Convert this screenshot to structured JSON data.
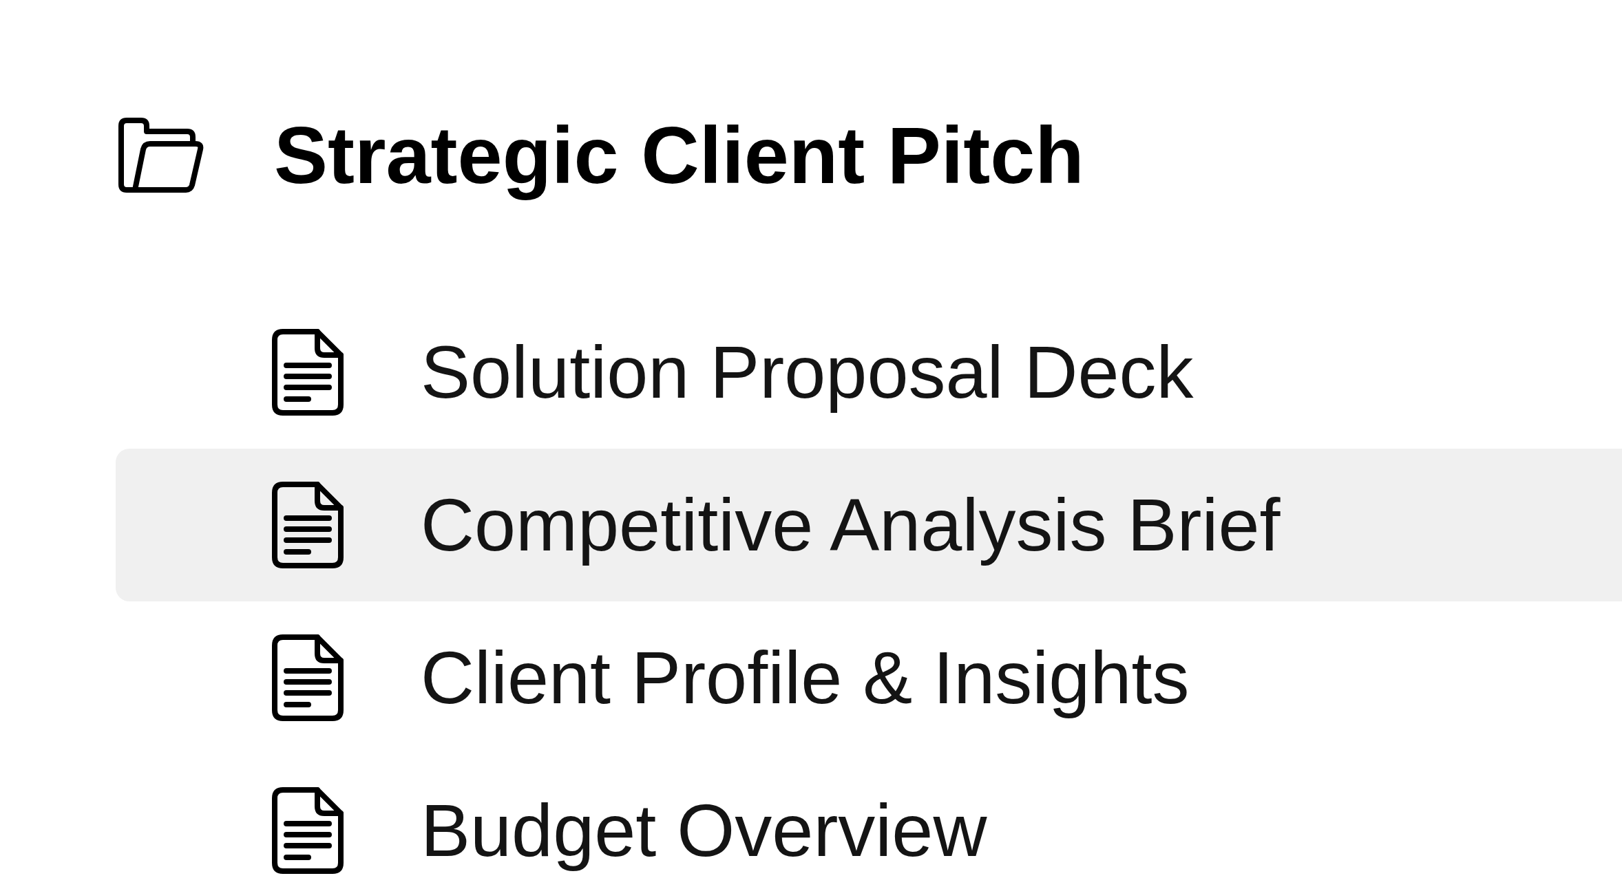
{
  "tree": {
    "name": "Strategic Client Pitch",
    "expanded": true,
    "children": [
      {
        "name": "Solution Proposal Deck",
        "selected": false
      },
      {
        "name": "Competitive Analysis Brief",
        "selected": true
      },
      {
        "name": "Client Profile & Insights",
        "selected": false
      },
      {
        "name": "Budget Overview",
        "selected": false
      }
    ]
  }
}
